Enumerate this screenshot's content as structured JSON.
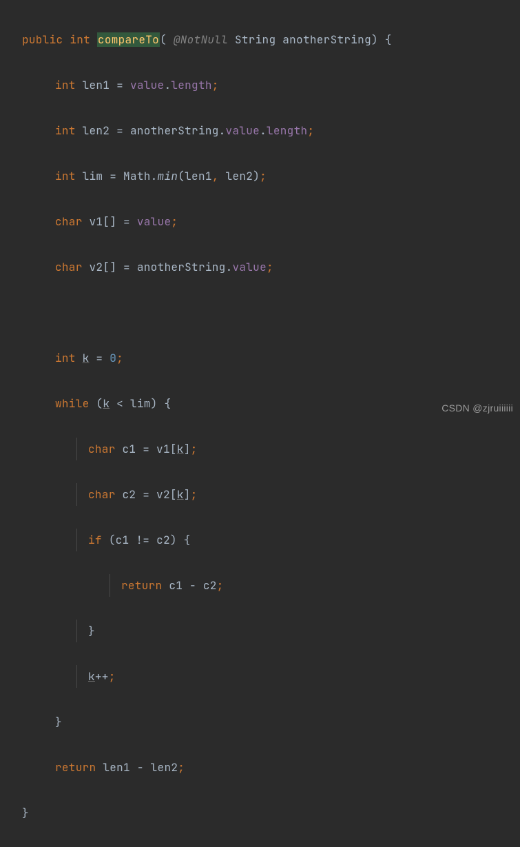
{
  "code": {
    "l1": {
      "kw_public": "public",
      "kw_int": "int",
      "method": "compareTo",
      "ann": "@NotNull",
      "ptype": "String",
      "pname": "anotherString"
    },
    "l2": {
      "kw_int": "int",
      "var": "len1",
      "eq": "=",
      "field": "value",
      "prop": "length"
    },
    "l3": {
      "kw_int": "int",
      "var": "len2",
      "eq": "=",
      "p": "anotherString",
      "field": "value",
      "prop": "length"
    },
    "l4": {
      "kw_int": "int",
      "var": "lim",
      "eq": "=",
      "cls": "Math",
      "m": "min",
      "a1": "len1",
      "a2": "len2"
    },
    "l5": {
      "kw_char": "char",
      "var": "v1",
      "br": "[]",
      "eq": "=",
      "field": "value"
    },
    "l6": {
      "kw_char": "char",
      "var": "v2",
      "br": "[]",
      "eq": "=",
      "p": "anotherString",
      "field": "value"
    },
    "l8": {
      "kw_int": "int",
      "var": "k",
      "eq": "=",
      "num": "0"
    },
    "l9": {
      "kw_while": "while",
      "v1": "k",
      "op": "<",
      "v2": "lim"
    },
    "l10": {
      "kw_char": "char",
      "var": "c1",
      "eq": "=",
      "arr": "v1",
      "idx": "k"
    },
    "l11": {
      "kw_char": "char",
      "var": "c2",
      "eq": "=",
      "arr": "v2",
      "idx": "k"
    },
    "l12": {
      "kw_if": "if",
      "a": "c1",
      "op": "!=",
      "b": "c2"
    },
    "l13": {
      "kw_return": "return",
      "a": "c1",
      "op": "-",
      "b": "c2"
    },
    "l14": {
      "brace": "}"
    },
    "l15": {
      "v": "k",
      "op": "++"
    },
    "l16": {
      "brace": "}"
    },
    "l17": {
      "kw_return": "return",
      "a": "len1",
      "op": "-",
      "b": "len2"
    },
    "l18": {
      "brace": "}"
    }
  },
  "watermark": "CSDN @zjruiiiiii"
}
